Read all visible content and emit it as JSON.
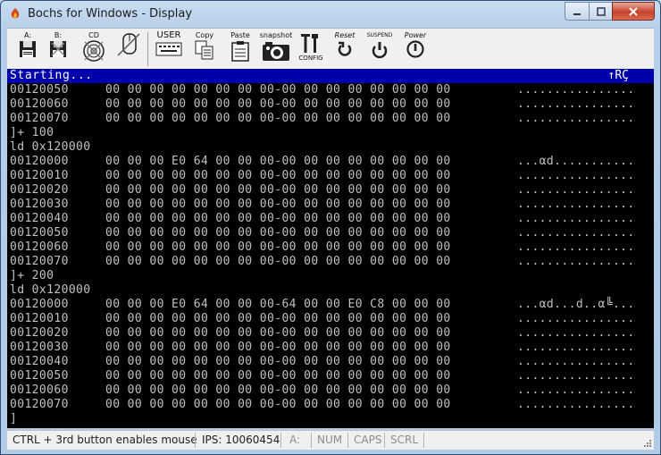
{
  "window": {
    "title": "Bochs for Windows - Display"
  },
  "toolbar": {
    "items": [
      {
        "label": "A:",
        "icon": "floppy-a-icon"
      },
      {
        "label": "B:",
        "icon": "floppy-b-icon"
      },
      {
        "label": "CD",
        "icon": "cdrom-icon"
      },
      {
        "label": "",
        "icon": "mouse-icon"
      },
      {
        "label": "USER",
        "icon": "keyboard-icon"
      },
      {
        "label": "Copy",
        "icon": "copy-icon"
      },
      {
        "label": "Paste",
        "icon": "paste-icon"
      },
      {
        "label": "snapshot",
        "icon": "camera-icon"
      },
      {
        "label": "CONFIG",
        "icon": "config-icon"
      },
      {
        "label": "Reset",
        "icon": "reset-icon"
      },
      {
        "label": "SUSPEND",
        "icon": "suspend-icon"
      },
      {
        "label": "Power",
        "icon": "power-icon"
      }
    ]
  },
  "console": {
    "header_text": "Starting...",
    "header_indicator": "↑RÇ",
    "lines": [
      {
        "type": "dump",
        "addr": "00120050",
        "hex": "00 00 00 00 00 00 00 00-00 00 00 00 00 00 00 00",
        "ascii": "................"
      },
      {
        "type": "dump",
        "addr": "00120060",
        "hex": "00 00 00 00 00 00 00 00-00 00 00 00 00 00 00 00",
        "ascii": "................"
      },
      {
        "type": "dump",
        "addr": "00120070",
        "hex": "00 00 00 00 00 00 00 00-00 00 00 00 00 00 00 00",
        "ascii": "................"
      },
      {
        "type": "cmd",
        "text": "]+ 100"
      },
      {
        "type": "cmd",
        "text": "ld 0x120000"
      },
      {
        "type": "dump",
        "addr": "00120000",
        "hex": "00 00 00 E0 64 00 00 00-00 00 00 00 00 00 00 00",
        "ascii": "...αd..........."
      },
      {
        "type": "dump",
        "addr": "00120010",
        "hex": "00 00 00 00 00 00 00 00-00 00 00 00 00 00 00 00",
        "ascii": "................"
      },
      {
        "type": "dump",
        "addr": "00120020",
        "hex": "00 00 00 00 00 00 00 00-00 00 00 00 00 00 00 00",
        "ascii": "................"
      },
      {
        "type": "dump",
        "addr": "00120030",
        "hex": "00 00 00 00 00 00 00 00-00 00 00 00 00 00 00 00",
        "ascii": "................"
      },
      {
        "type": "dump",
        "addr": "00120040",
        "hex": "00 00 00 00 00 00 00 00-00 00 00 00 00 00 00 00",
        "ascii": "................"
      },
      {
        "type": "dump",
        "addr": "00120050",
        "hex": "00 00 00 00 00 00 00 00-00 00 00 00 00 00 00 00",
        "ascii": "................"
      },
      {
        "type": "dump",
        "addr": "00120060",
        "hex": "00 00 00 00 00 00 00 00-00 00 00 00 00 00 00 00",
        "ascii": "................"
      },
      {
        "type": "dump",
        "addr": "00120070",
        "hex": "00 00 00 00 00 00 00 00-00 00 00 00 00 00 00 00",
        "ascii": "................"
      },
      {
        "type": "cmd",
        "text": "]+ 200"
      },
      {
        "type": "cmd",
        "text": "ld 0x120000"
      },
      {
        "type": "dump",
        "addr": "00120000",
        "hex": "00 00 00 E0 64 00 00 00-64 00 00 E0 C8 00 00 00",
        "ascii": "...αd...d..α╚..."
      },
      {
        "type": "dump",
        "addr": "00120010",
        "hex": "00 00 00 00 00 00 00 00-00 00 00 00 00 00 00 00",
        "ascii": "................"
      },
      {
        "type": "dump",
        "addr": "00120020",
        "hex": "00 00 00 00 00 00 00 00-00 00 00 00 00 00 00 00",
        "ascii": "................"
      },
      {
        "type": "dump",
        "addr": "00120030",
        "hex": "00 00 00 00 00 00 00 00-00 00 00 00 00 00 00 00",
        "ascii": "................"
      },
      {
        "type": "dump",
        "addr": "00120040",
        "hex": "00 00 00 00 00 00 00 00-00 00 00 00 00 00 00 00",
        "ascii": "................"
      },
      {
        "type": "dump",
        "addr": "00120050",
        "hex": "00 00 00 00 00 00 00 00-00 00 00 00 00 00 00 00",
        "ascii": "................"
      },
      {
        "type": "dump",
        "addr": "00120060",
        "hex": "00 00 00 00 00 00 00 00-00 00 00 00 00 00 00 00",
        "ascii": "................"
      },
      {
        "type": "dump",
        "addr": "00120070",
        "hex": "00 00 00 00 00 00 00 00-00 00 00 00 00 00 00 00",
        "ascii": "................"
      },
      {
        "type": "cmd",
        "text": "]"
      }
    ]
  },
  "status": {
    "mouse_hint": "CTRL + 3rd button enables mouse",
    "ips": "IPS: 10060454",
    "drive": "A:",
    "num": "NUM",
    "caps": "CAPS",
    "scrl": "SCRL"
  },
  "colors": {
    "console_bg": "#000000",
    "console_text": "#c0c0c0",
    "header_bg": "#0000aa",
    "header_text": "#ffffff"
  }
}
